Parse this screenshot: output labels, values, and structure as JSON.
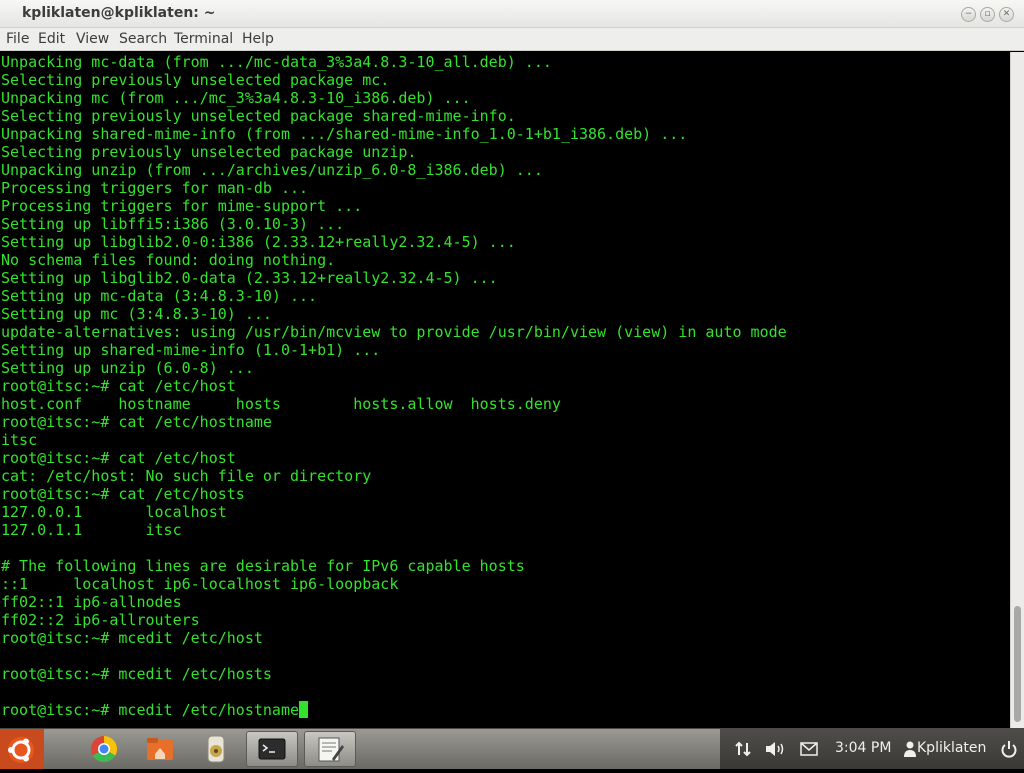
{
  "window": {
    "title": "kpliklaten@kpliklaten: ~",
    "controls": [
      "−",
      "▫",
      "✕"
    ]
  },
  "menu": [
    "File",
    "Edit",
    "View",
    "Search",
    "Terminal",
    "Help"
  ],
  "terminal": {
    "lines": [
      "Unpacking mc-data (from .../mc-data_3%3a4.8.3-10_all.deb) ...",
      "Selecting previously unselected package mc.",
      "Unpacking mc (from .../mc_3%3a4.8.3-10_i386.deb) ...",
      "Selecting previously unselected package shared-mime-info.",
      "Unpacking shared-mime-info (from .../shared-mime-info_1.0-1+b1_i386.deb) ...",
      "Selecting previously unselected package unzip.",
      "Unpacking unzip (from .../archives/unzip_6.0-8_i386.deb) ...",
      "Processing triggers for man-db ...",
      "Processing triggers for mime-support ...",
      "Setting up libffi5:i386 (3.0.10-3) ...",
      "Setting up libglib2.0-0:i386 (2.33.12+really2.32.4-5) ...",
      "No schema files found: doing nothing.",
      "Setting up libglib2.0-data (2.33.12+really2.32.4-5) ...",
      "Setting up mc-data (3:4.8.3-10) ...",
      "Setting up mc (3:4.8.3-10) ...",
      "update-alternatives: using /usr/bin/mcview to provide /usr/bin/view (view) in auto mode",
      "Setting up shared-mime-info (1.0-1+b1) ...",
      "Setting up unzip (6.0-8) ...",
      "root@itsc:~# cat /etc/host",
      "host.conf    hostname     hosts        hosts.allow  hosts.deny",
      "root@itsc:~# cat /etc/hostname",
      "itsc",
      "root@itsc:~# cat /etc/host",
      "cat: /etc/host: No such file or directory",
      "root@itsc:~# cat /etc/hosts",
      "127.0.0.1       localhost",
      "127.0.1.1       itsc",
      "",
      "# The following lines are desirable for IPv6 capable hosts",
      "::1     localhost ip6-localhost ip6-loopback",
      "ff02::1 ip6-allnodes",
      "ff02::2 ip6-allrouters",
      "root@itsc:~# mcedit /etc/host",
      "",
      "root@itsc:~# mcedit /etc/hosts",
      ""
    ],
    "current_prompt": "root@itsc:~# mcedit /etc/hostname",
    "text_color": "#33e22c",
    "background": "#000000"
  },
  "taskbar": {
    "launchers": [
      {
        "name": "ubuntu-logo-icon"
      },
      {
        "name": "chrome-icon"
      },
      {
        "name": "home-folder-icon"
      },
      {
        "name": "media-player-icon"
      },
      {
        "name": "terminal-icon"
      },
      {
        "name": "text-editor-icon"
      }
    ],
    "clock": "3:04 PM",
    "user": "Kpliklaten"
  }
}
